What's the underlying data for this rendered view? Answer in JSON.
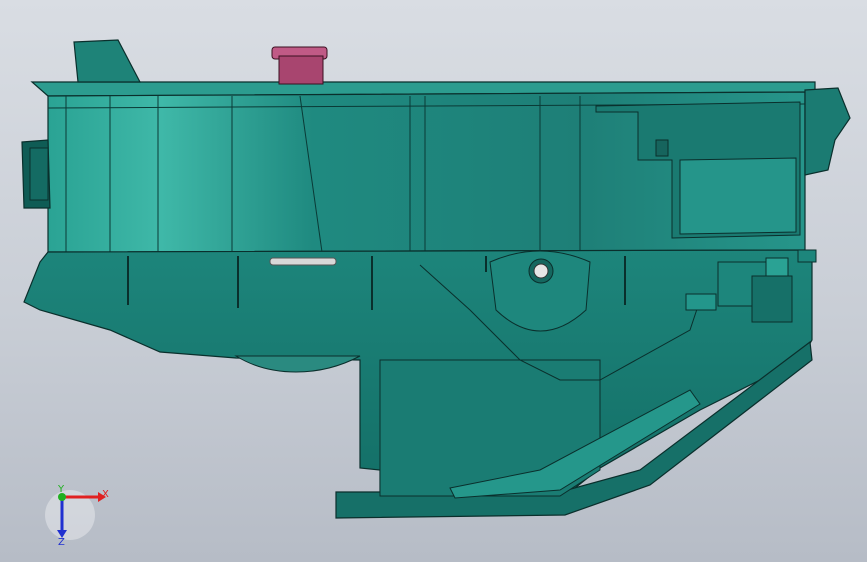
{
  "viewport": {
    "background_top": "#d9dde3",
    "background_bottom": "#b6bcc6"
  },
  "model": {
    "body_color": "#1f8a80",
    "body_dark": "#0f5f58",
    "body_light": "#3fb1a3",
    "edge_color": "#0a2f2c",
    "accent_part_color": "#c05a86",
    "washer_color": "#d8d8d8"
  },
  "triad": {
    "x_label": "X",
    "y_label": "Y",
    "z_label": "Z",
    "x_color": "#e02020",
    "y_color": "#20b020",
    "z_color": "#2030d0"
  }
}
